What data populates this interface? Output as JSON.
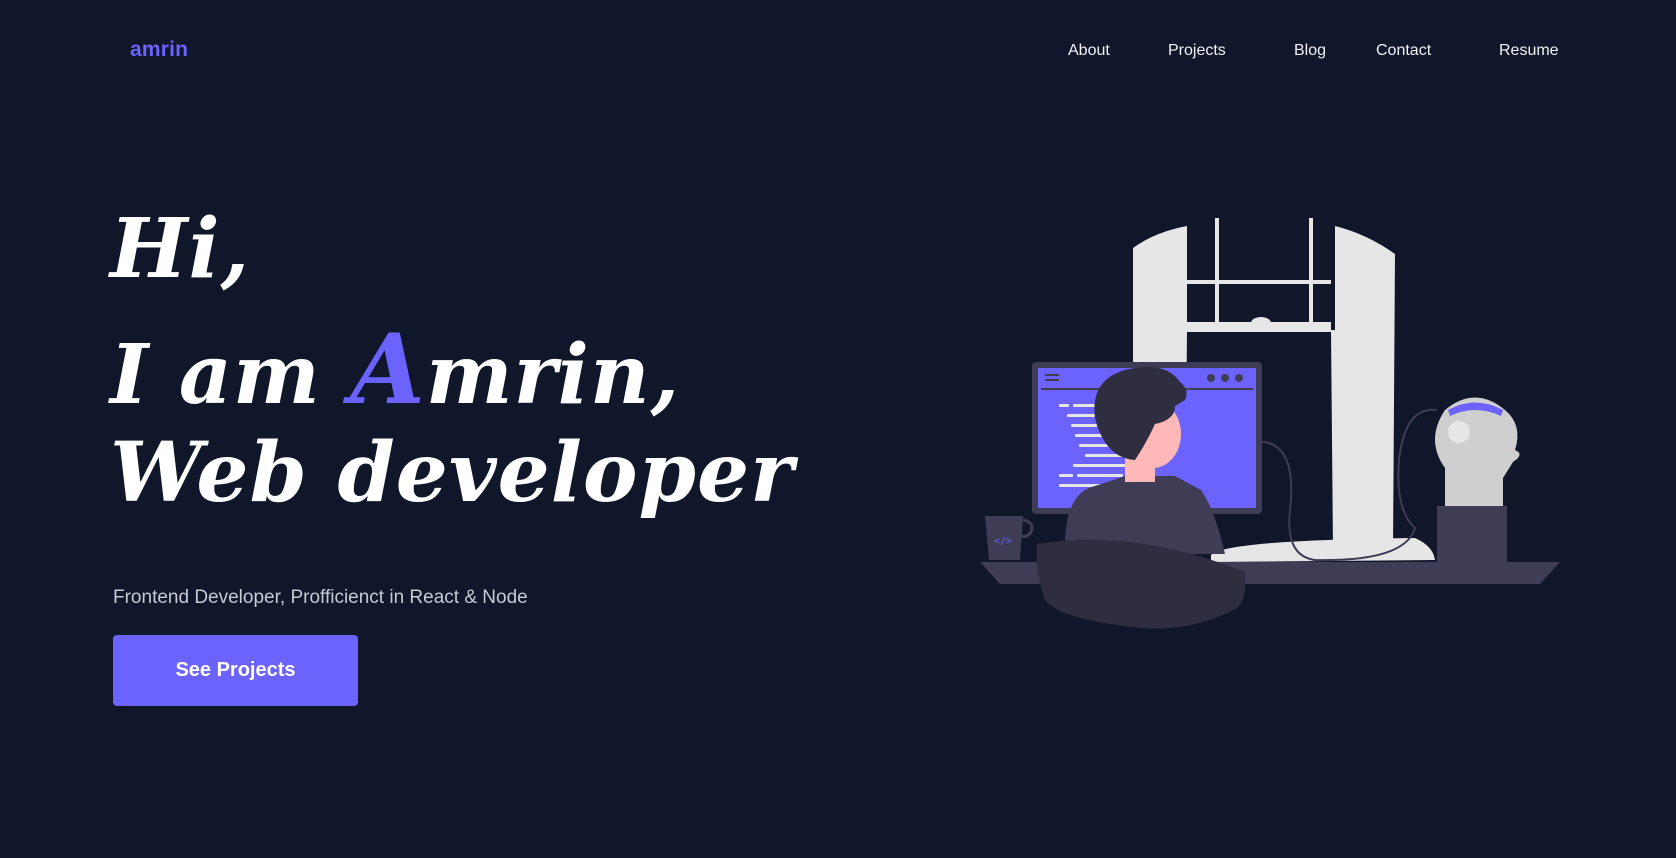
{
  "nav": {
    "logo": "amrin",
    "links": [
      {
        "label": "About"
      },
      {
        "label": "Projects"
      },
      {
        "label": "Blog"
      },
      {
        "label": "Contact"
      },
      {
        "label": "Resume"
      }
    ]
  },
  "hero": {
    "line1": "Hi,",
    "line2_prefix": "I am ",
    "line2_accent": "A",
    "line2_suffix": "mrin,",
    "line3": "Web developer",
    "subtitle": "Frontend Developer, Profficienct in React & Node",
    "cta_label": "See Projects"
  },
  "illustration": {
    "icon": "developer-at-desk-illustration",
    "mug_icon": "code-brackets-icon",
    "colors": {
      "accent": "#6c63ff",
      "window": "#e6e6e6",
      "desk": "#3f3d56",
      "chair": "#2f2e41",
      "skin": "#ffb8b8",
      "hair": "#2f2e41",
      "robot_head": "#cfcfcf"
    }
  },
  "colors": {
    "background": "#10172a",
    "accent": "#6c63ff",
    "text": "#ffffff",
    "subtext": "#c7c9d3"
  }
}
